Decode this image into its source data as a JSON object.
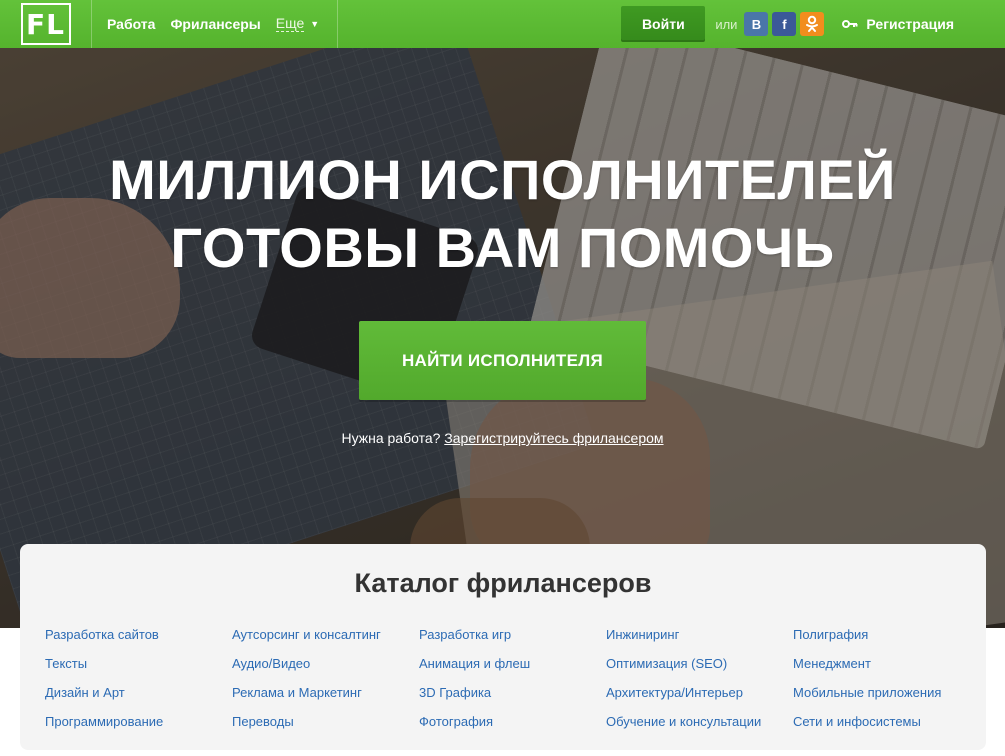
{
  "header": {
    "logo_text": "FL",
    "nav": [
      {
        "label": "Работа"
      },
      {
        "label": "Фрилансеры"
      }
    ],
    "more_label": "Еще",
    "login_label": "Войти",
    "or_label": "или",
    "social": [
      {
        "glyph": "В",
        "icon": "vk-icon",
        "color": "#4a76a8"
      },
      {
        "glyph": "f",
        "icon": "facebook-icon",
        "color": "#3b5998"
      },
      {
        "glyph": "ок",
        "icon": "odnoklassniki-icon",
        "color": "#f28d1d"
      }
    ],
    "register_label": "Регистрация"
  },
  "hero": {
    "title_line1": "МИЛЛИОН ИСПОЛНИТЕЛЕЙ",
    "title_line2": "ГОТОВЫ ВАМ ПОМОЧЬ",
    "cta_label": "НАЙТИ ИСПОЛНИТЕЛЯ",
    "need_work_text": "Нужна работа?",
    "need_work_link": "Зарегистрируйтесь фрилансером"
  },
  "catalog": {
    "title": "Каталог фрилансеров",
    "columns": [
      [
        "Разработка сайтов",
        "Тексты",
        "Дизайн и Арт",
        "Программирование"
      ],
      [
        "Аутсорсинг и консалтинг",
        "Аудио/Видео",
        "Реклама и Маркетинг",
        "Переводы"
      ],
      [
        "Разработка игр",
        "Анимация и флеш",
        "3D Графика",
        "Фотография"
      ],
      [
        "Инжиниринг",
        "Оптимизация (SEO)",
        "Архитектура/Интерьер",
        "Обучение и консультации"
      ],
      [
        "Полиграфия",
        "Менеджмент",
        "Мобильные приложения",
        "Сети и инфосистемы"
      ]
    ]
  },
  "colors": {
    "brand_green": "#5cb833",
    "link_blue": "#2c6bb4"
  }
}
